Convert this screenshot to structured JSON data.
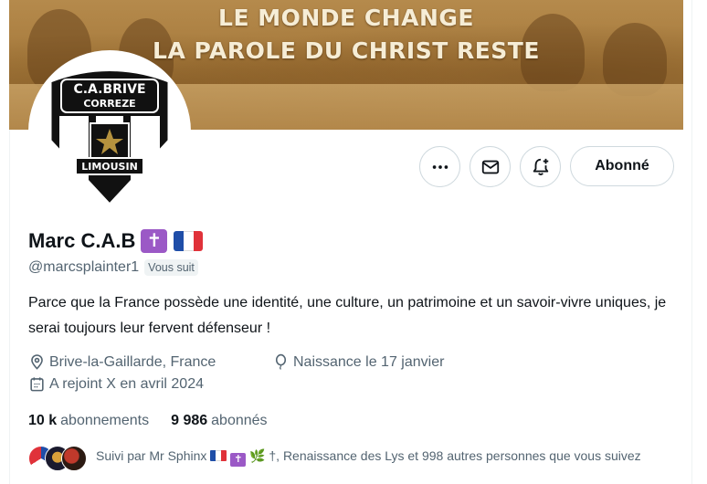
{
  "banner": {
    "line1": "LE MONDE CHANGE",
    "line2": "LA PAROLE DU CHRIST RESTE"
  },
  "avatar": {
    "logo_line1": "C.A.BRIVE",
    "logo_line2": "CORREZE",
    "logo_line3": "LIMOUSIN",
    "icon": "club-crest-icon"
  },
  "actions": {
    "more_icon": "more-icon",
    "message_icon": "mail-icon",
    "notify_icon": "bell-plus-icon",
    "follow_label": "Abonné"
  },
  "profile": {
    "display_name": "Marc C.A.B",
    "name_emoji_cross": "✝",
    "handle": "@marcsplainter1",
    "follows_you": "Vous suit",
    "bio": "Parce que la France possède une identité, une culture, un patrimoine et un savoir-vivre uniques, je serai toujours leur fervent défenseur !",
    "location": "Brive-la-Gaillarde, France",
    "birth": "Naissance le 17 janvier",
    "joined": "A rejoint X en avril 2024"
  },
  "stats": {
    "following_count": "10 k",
    "following_label": "abonnements",
    "followers_count": "9 986",
    "followers_label": "abonnés"
  },
  "followed_by": {
    "prefix": "Suivi par Mr Sphinx",
    "cross": "✝",
    "suffix": "🌿 †, Renaissance des Lys et 998 autres personnes que vous suivez"
  },
  "colors": {
    "flag_blue": "#1f4ea8",
    "flag_white": "#ffffff",
    "flag_red": "#e0323a",
    "cross_purple": "#9b59c6",
    "secondary_text": "#536471"
  }
}
